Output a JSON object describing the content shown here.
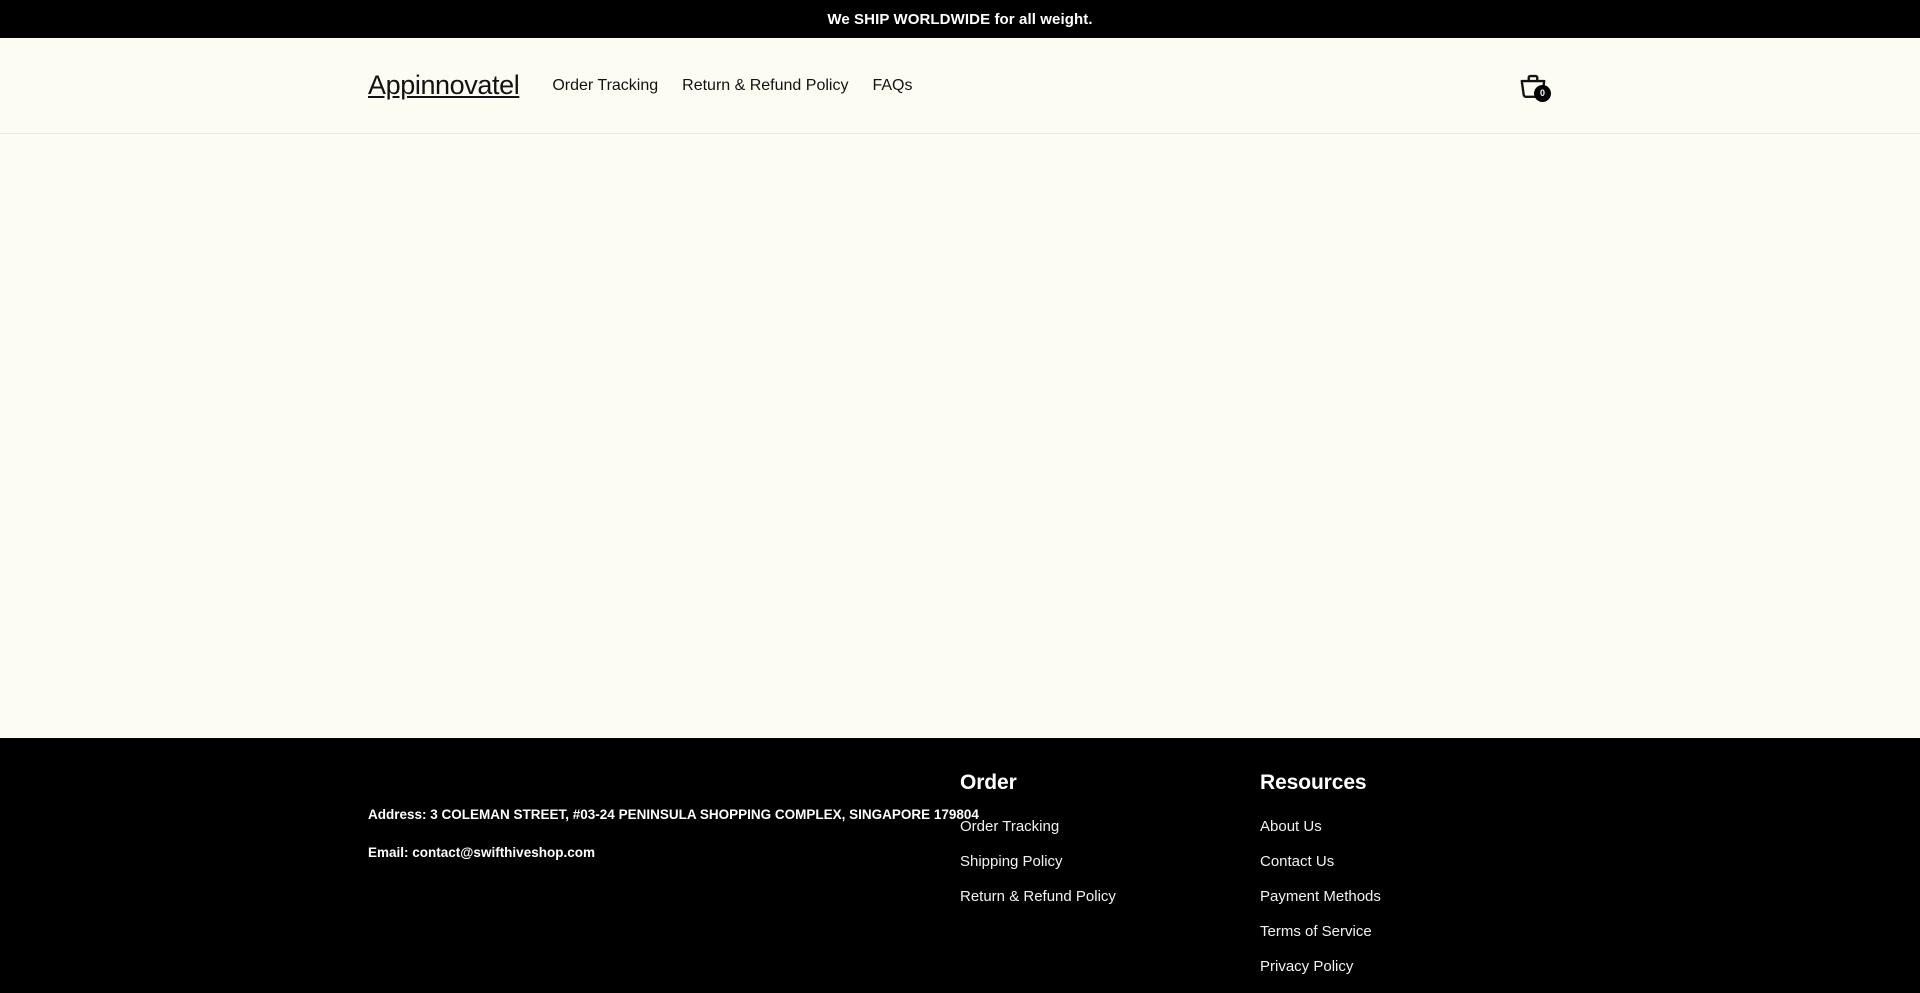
{
  "announcement": {
    "text": "We SHIP WORLDWIDE for all weight."
  },
  "header": {
    "logo": "Appinnovatel",
    "nav": [
      {
        "label": "Order Tracking"
      },
      {
        "label": "Return & Refund Policy"
      },
      {
        "label": "FAQs"
      }
    ],
    "cart": {
      "icon": "shopping-basket-icon",
      "count": "0"
    }
  },
  "footer": {
    "contact": {
      "address": "Address: 3 COLEMAN STREET, #03-24 PENINSULA SHOPPING COMPLEX, SINGAPORE 179804",
      "email": "Email: contact@swifthiveshop.com"
    },
    "columns": [
      {
        "heading": "Order",
        "links": [
          {
            "label": "Order Tracking"
          },
          {
            "label": "Shipping Policy"
          },
          {
            "label": "Return & Refund Policy"
          }
        ]
      },
      {
        "heading": "Resources",
        "links": [
          {
            "label": "About Us"
          },
          {
            "label": "Contact Us"
          },
          {
            "label": "Payment Methods"
          },
          {
            "label": "Terms of Service"
          },
          {
            "label": "Privacy Policy"
          }
        ]
      }
    ]
  },
  "colors": {
    "background": "#FDFCF3",
    "footer_background": "#000000",
    "announcement_background": "#000000",
    "text": "#121212",
    "footer_text": "#FFFFFF",
    "header_border": "#EDEADB"
  }
}
